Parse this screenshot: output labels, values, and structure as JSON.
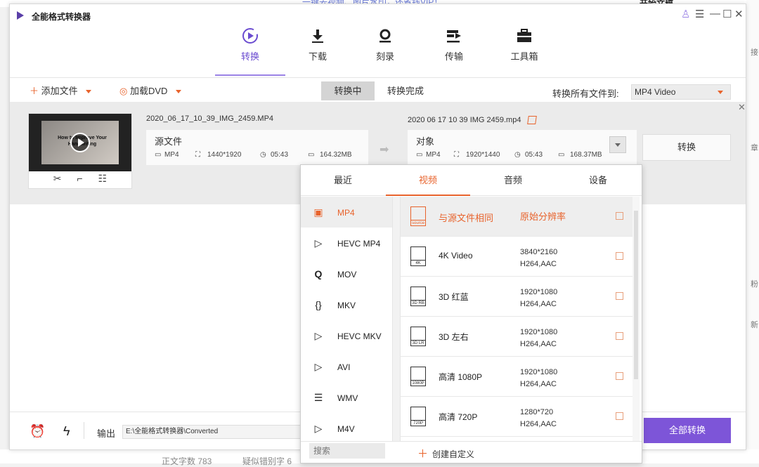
{
  "background": {
    "top_link": "一键去视频、图片水印，还省钱VIP！",
    "top_right": "开始文稿",
    "right_chars": [
      "接",
      "章",
      "粉",
      "新"
    ],
    "bottom_texts": [
      "正文字数 783",
      "疑似错别字 6"
    ]
  },
  "app": {
    "title": "全能格式转换器",
    "window_controls": [
      "♙",
      "☰",
      "—",
      "☐",
      "✕"
    ]
  },
  "nav": [
    {
      "label": "转换",
      "icon": "convert-icon",
      "active": true
    },
    {
      "label": "下载",
      "icon": "download-icon",
      "active": false
    },
    {
      "label": "刻录",
      "icon": "burn-icon",
      "active": false
    },
    {
      "label": "传输",
      "icon": "transfer-icon",
      "active": false
    },
    {
      "label": "工具箱",
      "icon": "toolbox-icon",
      "active": false
    }
  ],
  "toolbar": {
    "add_file": "添加文件",
    "load_dvd": "加载DVD",
    "tab_converting": "转换中",
    "tab_done": "转换完成",
    "convert_all_to_label": "转换所有文件到:",
    "convert_all_to_value": "MP4 Video"
  },
  "file": {
    "thumb_text": "How to Improve Your Handwriting",
    "source_name": "2020_06_17_10_39_IMG_2459.MP4",
    "source": {
      "title": "源文件",
      "format": "MP4",
      "resolution": "1440*1920",
      "duration": "05:43",
      "size": "164.32MB"
    },
    "target_name": "2020 06 17 10 39 IMG 2459.mp4",
    "target": {
      "title": "对象",
      "format": "MP4",
      "resolution": "1920*1440",
      "duration": "05:43",
      "size": "168.37MB"
    },
    "convert_button": "转换"
  },
  "bottom": {
    "output_label": "输出",
    "output_path": "E:\\全能格式转换器\\Converted",
    "convert_all_button": "全部转换"
  },
  "popup": {
    "tabs": [
      {
        "label": "最近",
        "active": false
      },
      {
        "label": "视频",
        "active": true
      },
      {
        "label": "音频",
        "active": false
      },
      {
        "label": "设备",
        "active": false
      }
    ],
    "formats": [
      {
        "label": "MP4",
        "icon": "film-icon",
        "glyph": "▣",
        "active": true
      },
      {
        "label": "HEVC MP4",
        "icon": "hevc-icon",
        "glyph": "▷",
        "active": false
      },
      {
        "label": "MOV",
        "icon": "quicktime-icon",
        "glyph": "Q",
        "active": false
      },
      {
        "label": "MKV",
        "icon": "mkv-icon",
        "glyph": "{}",
        "active": false
      },
      {
        "label": "HEVC MKV",
        "icon": "hevc-icon",
        "glyph": "▷",
        "active": false
      },
      {
        "label": "AVI",
        "icon": "avi-icon",
        "glyph": "▷",
        "active": false
      },
      {
        "label": "WMV",
        "icon": "wmv-icon",
        "glyph": "☰",
        "active": false
      },
      {
        "label": "M4V",
        "icon": "m4v-icon",
        "glyph": "▷",
        "active": false
      }
    ],
    "presets": [
      {
        "tag": "source",
        "name": "与源文件相同",
        "res": "原始分辨率",
        "codec": "",
        "active": true
      },
      {
        "tag": "4K",
        "name": "4K Video",
        "res": "3840*2160",
        "codec": "H264,AAC",
        "active": false
      },
      {
        "tag": "3D RB",
        "name": "3D 红蓝",
        "res": "1920*1080",
        "codec": "H264,AAC",
        "active": false
      },
      {
        "tag": "3D LR",
        "name": "3D 左右",
        "res": "1920*1080",
        "codec": "H264,AAC",
        "active": false
      },
      {
        "tag": "1080P",
        "name": "高清 1080P",
        "res": "1920*1080",
        "codec": "H264,AAC",
        "active": false
      },
      {
        "tag": "720P",
        "name": "高清 720P",
        "res": "1280*720",
        "codec": "H264,AAC",
        "active": false
      }
    ],
    "search_placeholder": "搜索",
    "create_custom": "创建自定义"
  },
  "colors": {
    "accent_purple": "#7d55d8",
    "accent_orange": "#e8632c"
  }
}
